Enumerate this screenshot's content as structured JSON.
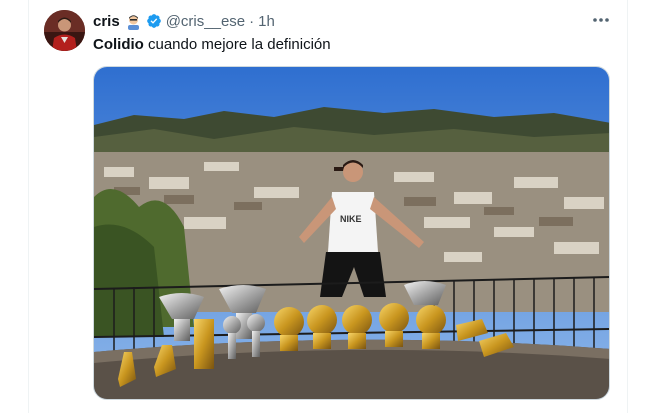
{
  "tweet": {
    "author_name": "cris",
    "author_emoji": "person-emoji",
    "verified_icon": "verified-badge-icon",
    "handle": "@cris__ese",
    "separator": "·",
    "time": "1h",
    "more_icon": "more-options-icon",
    "text_bold": "Colidio",
    "text_rest": " cuando mejore la definición",
    "media_icon": "photo-media"
  },
  "colors": {
    "accent": "#1d9bf0",
    "text": "#0f1419",
    "secondary": "#536471"
  }
}
